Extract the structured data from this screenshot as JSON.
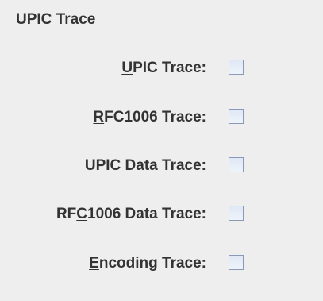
{
  "group": {
    "title": "UPIC Trace"
  },
  "options": [
    {
      "prefix": "",
      "mnemonic": "U",
      "suffix": "PIC Trace:",
      "checked": false
    },
    {
      "prefix": "",
      "mnemonic": "R",
      "suffix": "FC1006 Trace:",
      "checked": false
    },
    {
      "prefix": "U",
      "mnemonic": "P",
      "suffix": "IC Data Trace:",
      "checked": false
    },
    {
      "prefix": "RF",
      "mnemonic": "C",
      "suffix": "1006 Data Trace:",
      "checked": false
    },
    {
      "prefix": "",
      "mnemonic": "E",
      "suffix": "ncoding Trace:",
      "checked": false
    }
  ]
}
